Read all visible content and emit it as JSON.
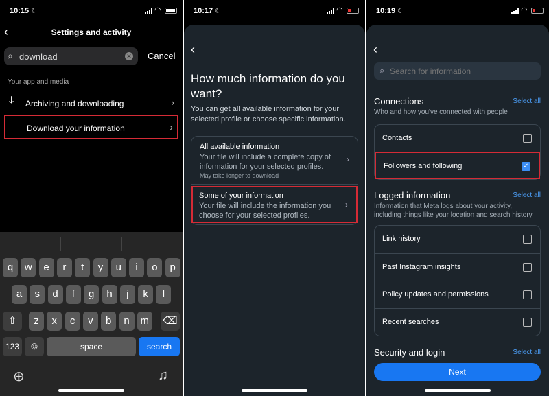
{
  "panel1": {
    "time": "10:15",
    "title": "Settings and activity",
    "search_value": "download",
    "cancel": "Cancel",
    "section": "Your app and media",
    "rows": [
      {
        "label": "Archiving and downloading"
      },
      {
        "label": "Download your information"
      }
    ],
    "keyboard": {
      "row1": [
        "q",
        "w",
        "e",
        "r",
        "t",
        "y",
        "u",
        "i",
        "o",
        "p"
      ],
      "row2": [
        "a",
        "s",
        "d",
        "f",
        "g",
        "h",
        "j",
        "k",
        "l"
      ],
      "row3": [
        "z",
        "x",
        "c",
        "v",
        "b",
        "n",
        "m"
      ],
      "num_key": "123",
      "space": "space",
      "search": "search"
    }
  },
  "panel2": {
    "time": "10:17",
    "heading": "How much information do you want?",
    "description": "You can get all available information for your selected profile or choose specific information.",
    "options": [
      {
        "title": "All available information",
        "subtitle": "Your file will include a complete copy of information for your selected profiles.",
        "note": "May take longer to download"
      },
      {
        "title": "Some of your information",
        "subtitle": "Your file will include the information you choose for your selected profiles."
      }
    ]
  },
  "panel3": {
    "time": "10:19",
    "search_placeholder": "Search for information",
    "select_all": "Select all",
    "sections": [
      {
        "title": "Connections",
        "desc": "Who and how you've connected with people",
        "items": [
          {
            "label": "Contacts",
            "checked": false
          },
          {
            "label": "Followers and following",
            "checked": true
          }
        ]
      },
      {
        "title": "Logged information",
        "desc": "Information that Meta logs about your activity, including things like your location and search history",
        "items": [
          {
            "label": "Link history",
            "checked": false
          },
          {
            "label": "Past Instagram insights",
            "checked": false
          },
          {
            "label": "Policy updates and permissions",
            "checked": false
          },
          {
            "label": "Recent searches",
            "checked": false
          }
        ]
      },
      {
        "title": "Security and login",
        "desc": "",
        "items": []
      }
    ],
    "next": "Next"
  },
  "colors": {
    "accent": "#1877f2",
    "highlight": "#d52b36",
    "sheet": "#1c242b"
  }
}
